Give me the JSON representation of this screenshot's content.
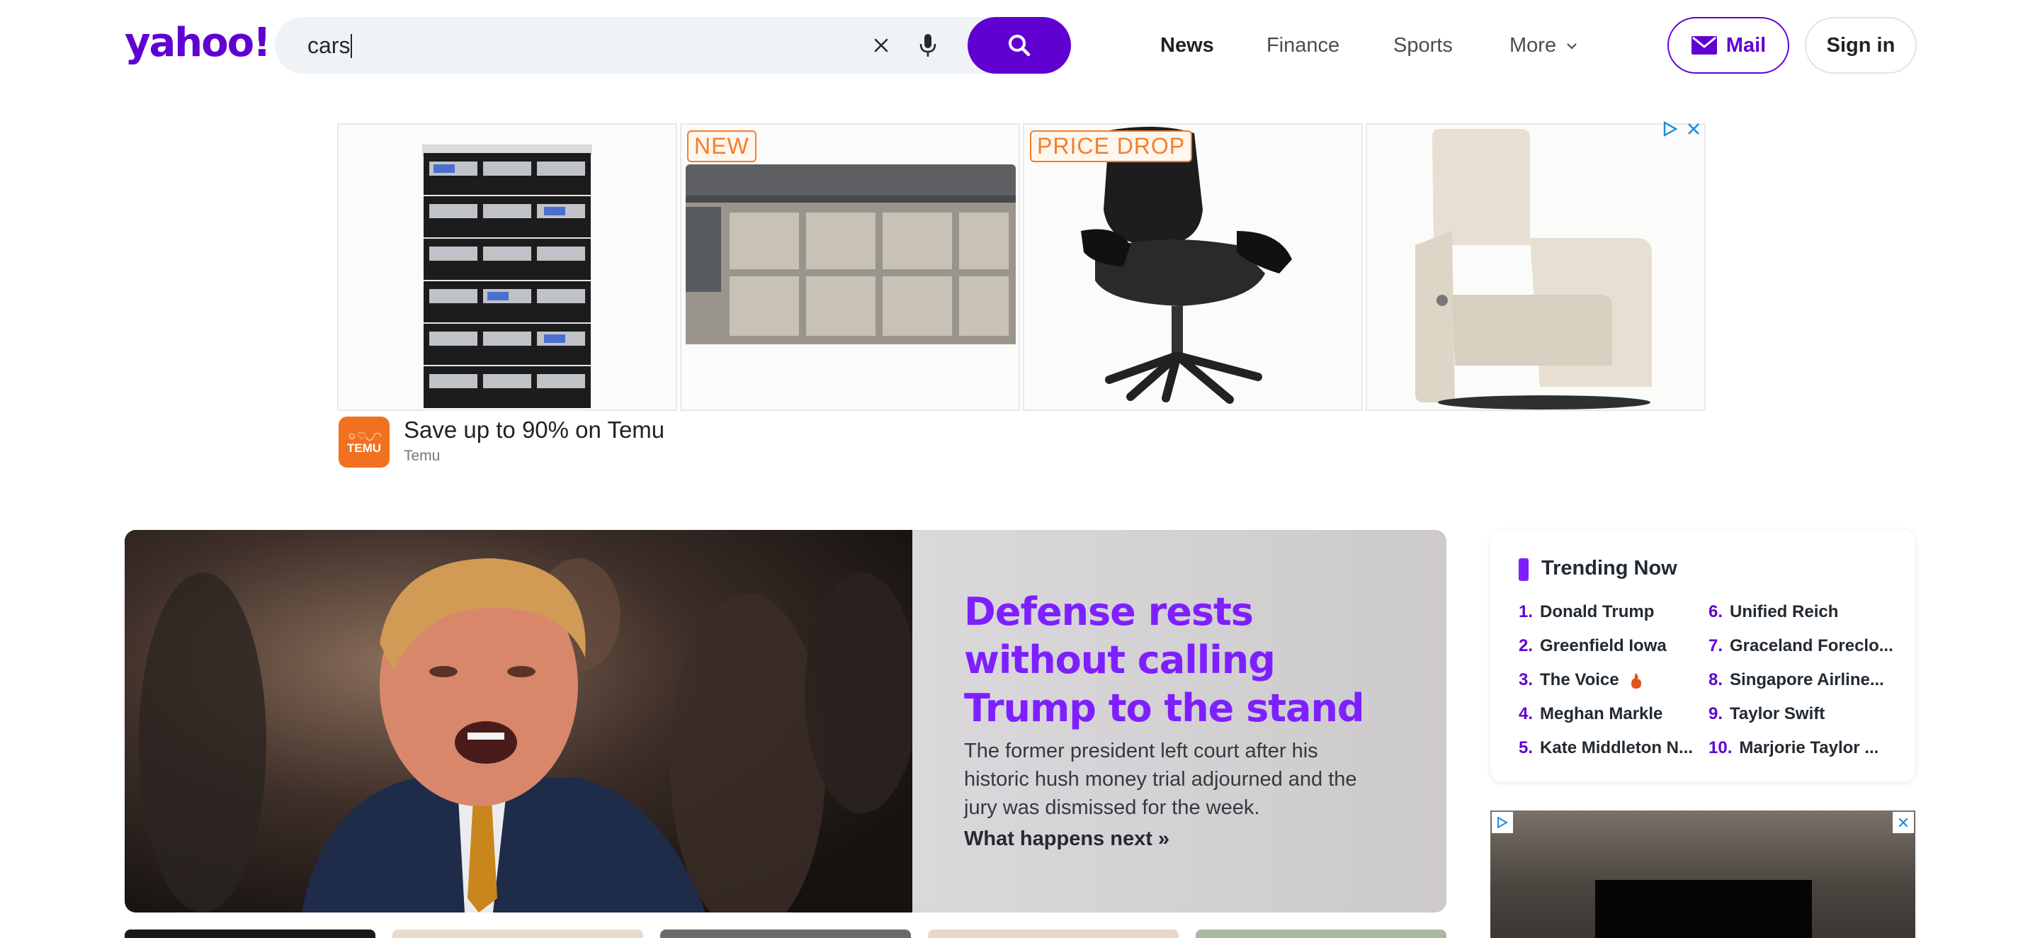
{
  "header": {
    "logo_text": "yahoo!",
    "search": {
      "value": "cars",
      "clear_icon": "close-icon",
      "mic_icon": "microphone-icon",
      "search_icon": "search-icon"
    },
    "nav": [
      "News",
      "Finance",
      "Sports",
      "More"
    ],
    "active_nav": "News",
    "mail_label": "Mail",
    "signin_label": "Sign in"
  },
  "ad_banner": {
    "tiles": [
      {
        "product": "shoe-rack",
        "badge": ""
      },
      {
        "product": "storage-bench",
        "badge": "NEW"
      },
      {
        "product": "office-chair",
        "badge": "PRICE DROP"
      },
      {
        "product": "recliner",
        "badge": ""
      }
    ],
    "title": "Save up to 90% on Temu",
    "sponsor": "Temu",
    "logo_text": "TEMU"
  },
  "hero": {
    "title": "Defense rests without calling Trump to the stand",
    "description": "The former president left court after his historic hush money trial adjourned and the jury was dismissed for the week.",
    "link": "What happens next »"
  },
  "trending": {
    "heading": "Trending Now",
    "items": [
      {
        "num": "1.",
        "label": "Donald Trump"
      },
      {
        "num": "2.",
        "label": "Greenfield Iowa"
      },
      {
        "num": "3.",
        "label": "The Voice",
        "hot": true
      },
      {
        "num": "4.",
        "label": "Meghan Markle"
      },
      {
        "num": "5.",
        "label": "Kate Middleton N..."
      },
      {
        "num": "6.",
        "label": "Unified Reich"
      },
      {
        "num": "7.",
        "label": "Graceland Foreclo..."
      },
      {
        "num": "8.",
        "label": "Singapore Airline..."
      },
      {
        "num": "9.",
        "label": "Taylor Swift"
      },
      {
        "num": "10.",
        "label": "Marjorie Taylor ..."
      }
    ]
  },
  "colors": {
    "brand": "#6001d2",
    "headline": "#7e1fff",
    "temu": "#f2711f"
  }
}
